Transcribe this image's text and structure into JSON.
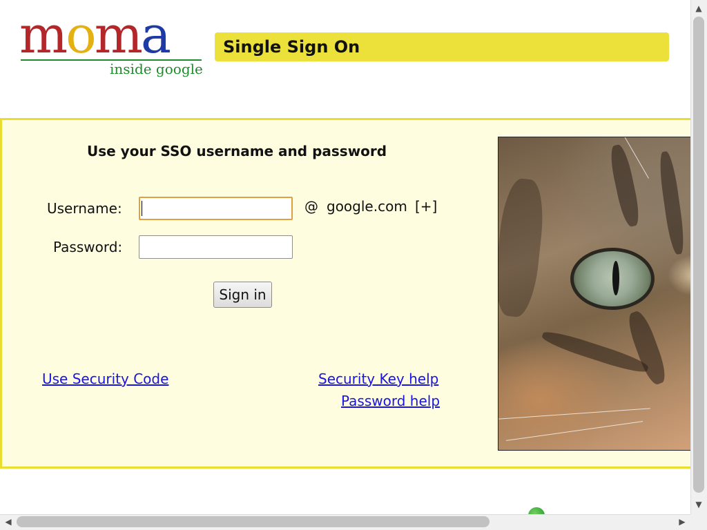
{
  "header": {
    "logo_letters": [
      "m",
      "o",
      "m",
      "a"
    ],
    "logo_colors": [
      "#b3262a",
      "#e5b014",
      "#b3262a",
      "#1d3aa6"
    ],
    "logo_subtitle": "inside google",
    "title": "Single Sign On"
  },
  "form": {
    "heading": "Use your SSO username and password",
    "username_label": "Username:",
    "username_value": "",
    "at_sign": "@",
    "domain": "google.com",
    "domain_expand": "[+]",
    "password_label": "Password:",
    "password_value": "",
    "submit_label": "Sign in"
  },
  "links": {
    "security_code": "Use Security Code",
    "security_key_help": "Security Key help",
    "password_help": "Password help"
  },
  "photo": {
    "subject": "cat-eye-closeup"
  },
  "colors": {
    "title_bar": "#ece03a",
    "panel_background": "#fefddf",
    "panel_border": "#e9dd2f",
    "link": "#1a14e0",
    "focus_ring": "#e0a040"
  },
  "scrollbars": {
    "vertical_up_icon": "▲",
    "vertical_down_icon": "▼",
    "horizontal_left_icon": "◀",
    "horizontal_right_icon": "▶"
  }
}
